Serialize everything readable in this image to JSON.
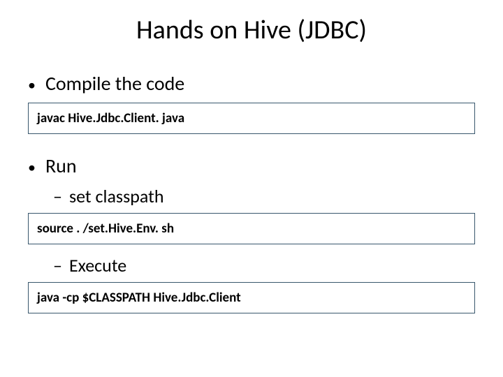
{
  "title": "Hands on Hive (JDBC)",
  "bullets": {
    "compile": "Compile the code",
    "run": "Run",
    "setclasspath": "set classpath",
    "execute": "Execute"
  },
  "code": {
    "compile": "javac Hive.Jdbc.Client. java",
    "source": "source . /set.Hive.Env. sh",
    "run": "java -cp $CLASSPATH Hive.Jdbc.Client"
  }
}
